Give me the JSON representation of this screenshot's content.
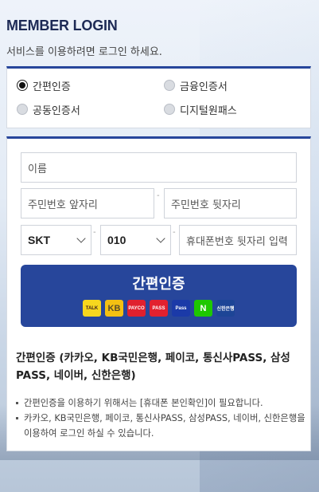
{
  "header": {
    "title": "MEMBER LOGIN",
    "subtitle": "서비스를 이용하려면 로그인 하세요."
  },
  "auth_methods": [
    {
      "label": "간편인증",
      "selected": true
    },
    {
      "label": "금융인증서",
      "selected": false
    },
    {
      "label": "공동인증서",
      "selected": false
    },
    {
      "label": "디지털원패스",
      "selected": false
    }
  ],
  "form": {
    "name_placeholder": "이름",
    "rrn_front_placeholder": "주민번호 앞자리",
    "rrn_back_placeholder": "주민번호 뒷자리",
    "carrier_value": "SKT",
    "phone_prefix_value": "010",
    "phone_rest_placeholder": "휴대폰번호 뒷자리 입력",
    "dash": "-"
  },
  "simple_auth_button": {
    "label": "간편인증",
    "logos": [
      {
        "icon": "kakao-talk-icon",
        "text": "TALK",
        "bg": "#f7d71e",
        "fg": "#3b1e1e"
      },
      {
        "icon": "kb-bank-icon",
        "text": "KB",
        "bg": "#f4c012",
        "fg": "#5a4b2b"
      },
      {
        "icon": "payco-icon",
        "text": "PAYCO",
        "bg": "#e0202e",
        "fg": "#ffffff"
      },
      {
        "icon": "pass-icon",
        "text": "PASS",
        "bg": "#e2212f",
        "fg": "#ffffff"
      },
      {
        "icon": "samsung-pass-icon",
        "text": "Pass",
        "bg": "#1b3aa8",
        "fg": "#ffffff"
      },
      {
        "icon": "naver-icon",
        "text": "N",
        "bg": "#1ec800",
        "fg": "#ffffff"
      },
      {
        "icon": "shinhan-bank-icon",
        "text": "신한은행",
        "bg": "#1d4596",
        "fg": "#ffffff"
      }
    ]
  },
  "info": {
    "title": "간편인증 (카카오, KB국민은행, 페이코, 통신사PASS, 삼성PASS, 네이버, 신한은행)",
    "notes": [
      "간편인증을 이용하기 위해서는 [휴대폰 본인확인]이 필요합니다.",
      "카카오, KB국민은행, 페이코, 통신사PASS, 삼성PASS, 네이버, 신한은행을 이용하여 로그인 하실 수 있습니다."
    ]
  },
  "colors": {
    "brand_blue": "#27469b",
    "title_navy": "#1d2a55"
  }
}
